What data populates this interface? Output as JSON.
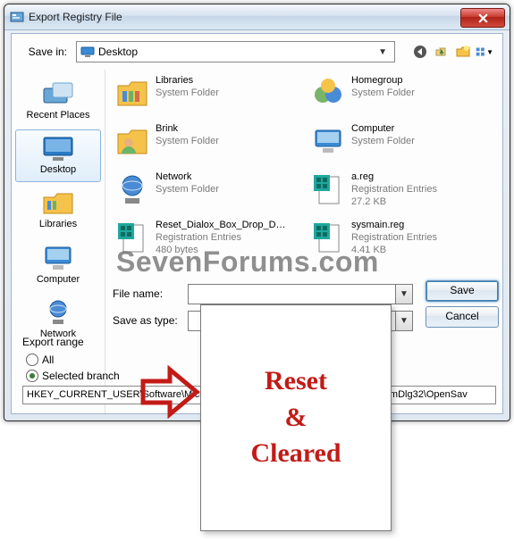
{
  "window": {
    "title": "Export Registry File"
  },
  "savein": {
    "label": "Save in:",
    "value": "Desktop"
  },
  "toolbar": {
    "back": "back-icon",
    "up": "up-icon",
    "newfolder": "new-folder-icon",
    "views": "views-icon"
  },
  "places": [
    {
      "key": "recent",
      "label": "Recent Places"
    },
    {
      "key": "desktop",
      "label": "Desktop",
      "selected": true
    },
    {
      "key": "libraries",
      "label": "Libraries"
    },
    {
      "key": "computer",
      "label": "Computer"
    },
    {
      "key": "network",
      "label": "Network"
    }
  ],
  "files": [
    {
      "name": "Libraries",
      "meta1": "System Folder",
      "meta2": "",
      "icon": "folder-lib"
    },
    {
      "name": "Homegroup",
      "meta1": "System Folder",
      "meta2": "",
      "icon": "homegroup"
    },
    {
      "name": "Brink",
      "meta1": "System Folder",
      "meta2": "",
      "icon": "userfolder"
    },
    {
      "name": "Computer",
      "meta1": "System Folder",
      "meta2": "",
      "icon": "computer"
    },
    {
      "name": "Network",
      "meta1": "System Folder",
      "meta2": "",
      "icon": "network"
    },
    {
      "name": "a.reg",
      "meta1": "Registration Entries",
      "meta2": "27.2 KB",
      "icon": "reg"
    },
    {
      "name": "Reset_Dialox_Box_Drop_Dow...",
      "meta1": "Registration Entries",
      "meta2": "480 bytes",
      "icon": "reg"
    },
    {
      "name": "sysmain.reg",
      "meta1": "Registration Entries",
      "meta2": "4.41 KB",
      "icon": "reg"
    }
  ],
  "form": {
    "filename_label": "File name:",
    "filename_value": "",
    "saveastype_label": "Save as type:"
  },
  "buttons": {
    "save": "Save",
    "cancel": "Cancel"
  },
  "export": {
    "legend": "Export range",
    "all_label": "All",
    "selected_label": "Selected branch",
    "selected_checked": true,
    "branch_value": "HKEY_CURRENT_USER\\Software\\Microsoft\\Windows\\CurrentVersion\\Explorer\\ComDlg32\\OpenSav"
  },
  "watermark": "SevenForums.com",
  "annotation": {
    "line1": "Reset",
    "line2": "&",
    "line3": "Cleared"
  }
}
